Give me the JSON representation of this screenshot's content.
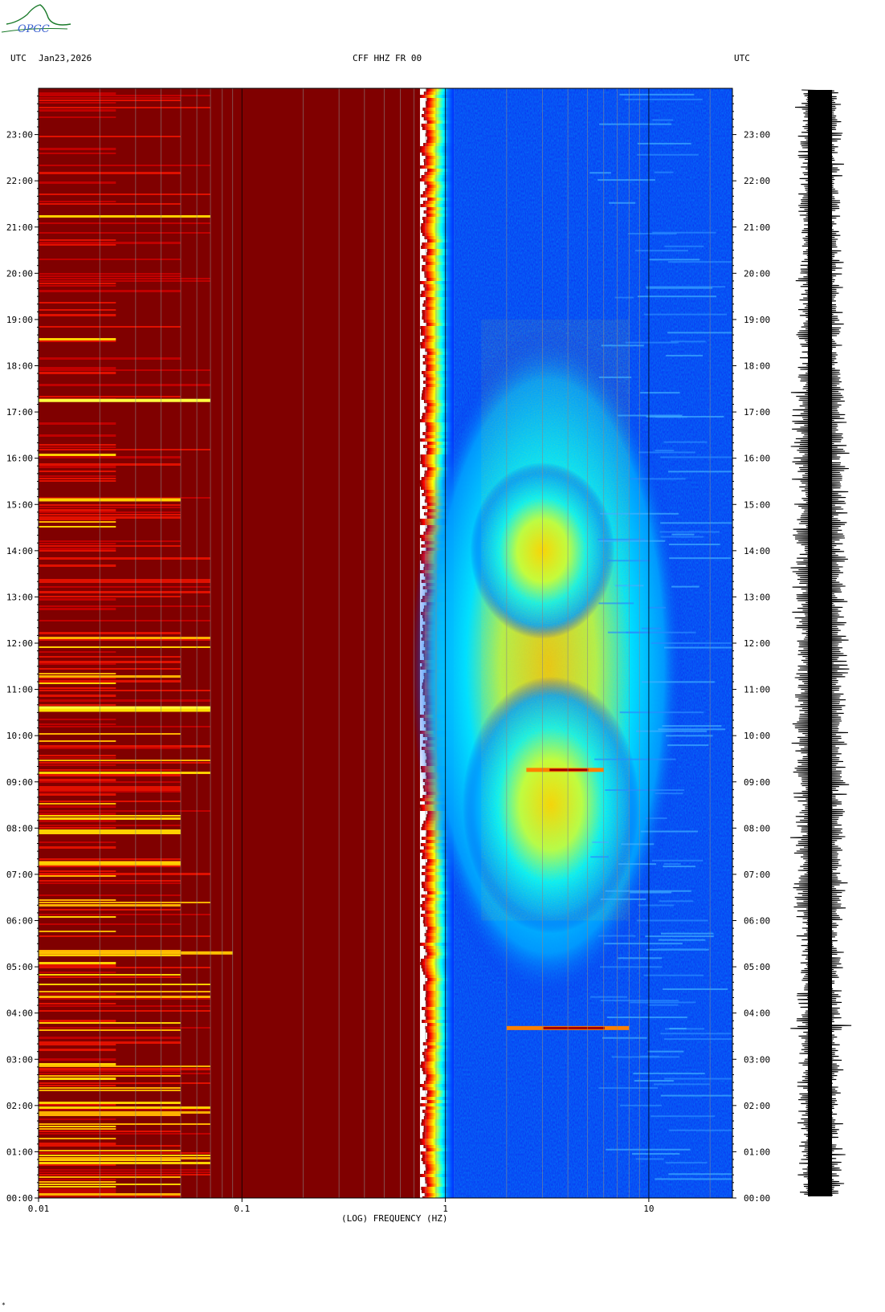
{
  "logo": {
    "text": "OPGC",
    "color": "#1a7a2a",
    "accent": "#3a5fd0"
  },
  "header": {
    "left_utc": "UTC",
    "date": "Jan23,2026",
    "station": "CFF HHZ FR 00",
    "right_utc": "UTC"
  },
  "footer": {
    "mark": "*"
  },
  "chart_data": {
    "type": "heatmap",
    "title": "CFF HHZ FR 00",
    "xlabel": "(LOG) FREQUENCY (HZ)",
    "ylabel": "",
    "x_scale": "log",
    "xlim": [
      0.01,
      25
    ],
    "x_tick_labels": [
      "0.01",
      "0.1",
      "1",
      "10"
    ],
    "x_tick_values": [
      0.01,
      0.1,
      1,
      10
    ],
    "x_grid": [
      0.02,
      0.03,
      0.04,
      0.05,
      0.06,
      0.07,
      0.08,
      0.09,
      0.1,
      0.2,
      0.3,
      0.4,
      0.5,
      0.6,
      0.7,
      0.8,
      0.9,
      1,
      2,
      3,
      4,
      5,
      6,
      7,
      8,
      9,
      10,
      20
    ],
    "ylim_hours": [
      0,
      24
    ],
    "y_tick_labels": [
      "00:00",
      "01:00",
      "02:00",
      "03:00",
      "04:00",
      "05:00",
      "06:00",
      "07:00",
      "08:00",
      "09:00",
      "10:00",
      "11:00",
      "12:00",
      "13:00",
      "14:00",
      "15:00",
      "16:00",
      "17:00",
      "18:00",
      "19:00",
      "20:00",
      "21:00",
      "22:00",
      "23:00"
    ],
    "y_tick_hours": [
      0,
      1,
      2,
      3,
      4,
      5,
      6,
      7,
      8,
      9,
      10,
      11,
      12,
      13,
      14,
      15,
      16,
      17,
      18,
      19,
      20,
      21,
      22,
      23
    ],
    "colormap": [
      "#00007f",
      "#0000ff",
      "#0080ff",
      "#00ffff",
      "#80ff80",
      "#ffff00",
      "#ff8000",
      "#ff0000",
      "#800000"
    ],
    "events": [
      {
        "time": "03:40",
        "freq_range_hz": [
          2,
          8
        ]
      },
      {
        "time": "09:15",
        "freq_range_hz": [
          2.5,
          6
        ]
      }
    ],
    "trace_color": "#000000"
  }
}
